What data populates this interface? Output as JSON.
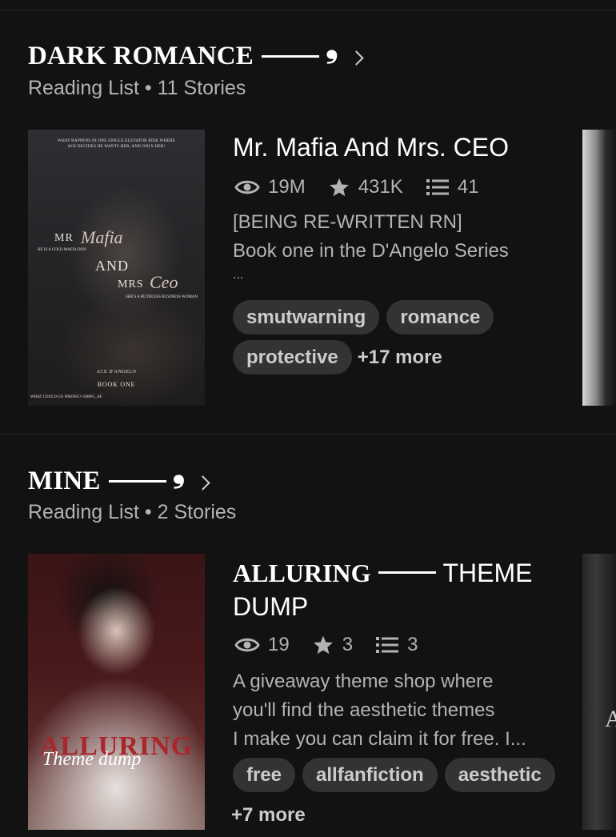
{
  "sections": [
    {
      "title": "DARK ROMANCE",
      "subtitle": "Reading List • 11 Stories",
      "story": {
        "title": "Mr. Mafia And Mrs. CEO",
        "stats": {
          "reads": "19M",
          "votes": "431K",
          "parts": "41"
        },
        "description": [
          "[BEING RE-WRITTEN RN]",
          "Book one in the D'Angelo Series",
          "..."
        ],
        "tags": [
          "smutwarning",
          "romance",
          "protective"
        ],
        "more_tags": "+17 more",
        "cover": {
          "top_text_1": "WHAT HAPPENS IN ONE SINGLE ELEVATOR RIDE WHERE",
          "top_text_2": "ACE DECIDES HE WANTS HER, AND ONLY HER!",
          "mr": "MR",
          "mafia": "Mafia",
          "tagline_1": "HE IS A COLD MAFIA DON",
          "and": "AND",
          "mrs": "MRS",
          "ceo": "Ceo",
          "tagline_2": "SHE'S A RUTHLESS BUSINESS WOMAN",
          "author": "ACE D'ANGELO",
          "book": "BOOK ONE",
          "bottom_text": "WHAT COULD GO WRONG?~DMFG_AF"
        }
      }
    },
    {
      "title": "MINE",
      "subtitle": "Reading List • 2 Stories",
      "story": {
        "title_serif": "ALLURING",
        "title_rest_1": "THEME",
        "title_rest_2": "DUMP",
        "stats": {
          "reads": "19",
          "votes": "3",
          "parts": "3"
        },
        "description": [
          "A giveaway theme shop where",
          "you'll find the aesthetic themes",
          "I make you can claim it for free. I..."
        ],
        "tags": [
          "free",
          "allfanfiction",
          "aesthetic"
        ],
        "more_tags": "+7 more",
        "cover": {
          "title": "ALLURING",
          "script": "Theme dump"
        }
      }
    }
  ],
  "peek_cover_2_letter": "A",
  "icons": {
    "reads": "eye-icon",
    "votes": "star-icon",
    "parts": "list-icon",
    "open_list": "chevron-right-icon"
  }
}
